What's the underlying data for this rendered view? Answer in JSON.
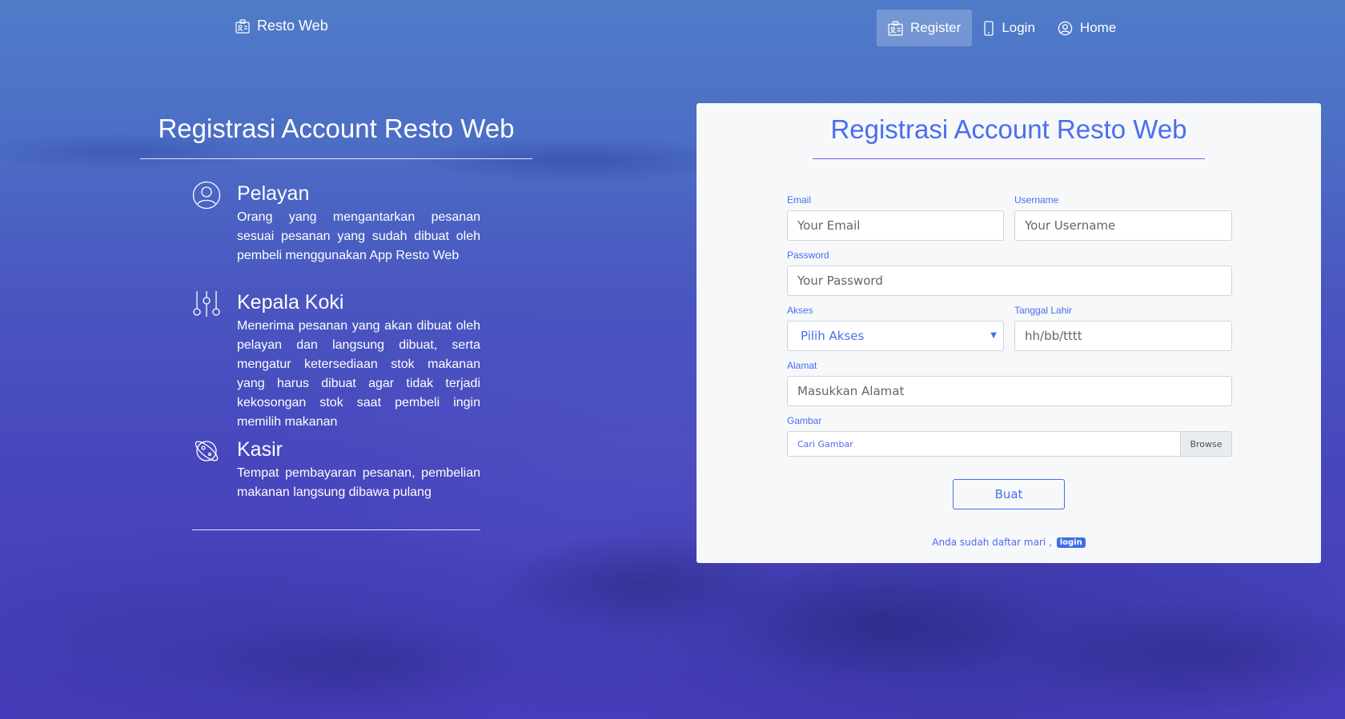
{
  "navbar": {
    "brand": "Resto Web",
    "items": [
      {
        "label": "Register",
        "icon": "id-card-icon",
        "active": true
      },
      {
        "label": "Login",
        "icon": "phone-icon",
        "active": false
      },
      {
        "label": "Home",
        "icon": "user-circle-icon",
        "active": false
      }
    ]
  },
  "left": {
    "title": "Registrasi Account Resto Web",
    "roles": [
      {
        "title": "Pelayan",
        "icon": "user-circle-icon",
        "description": "Orang yang mengantarkan pesanan sesuai pesanan yang sudah dibuat oleh pembeli menggunakan App Resto Web"
      },
      {
        "title": "Kepala Koki",
        "icon": "sliders-icon",
        "description": "Menerima pesanan yang akan dibuat oleh pelayan dan langsung dibuat, serta mengatur ketersediaan stok makanan yang harus dibuat agar tidak terjadi kekosongan stok saat pembeli ingin memilih makanan"
      },
      {
        "title": "Kasir",
        "icon": "planet-icon",
        "description": "Tempat pembayaran pesanan, pembelian makanan langsung dibawa pulang"
      }
    ]
  },
  "form": {
    "title": "Registrasi Account Resto Web",
    "email": {
      "label": "Email",
      "placeholder": "Your Email"
    },
    "username": {
      "label": "Username",
      "placeholder": "Your Username"
    },
    "password": {
      "label": "Password",
      "placeholder": "Your Password"
    },
    "akses": {
      "label": "Akses",
      "selected": "Pilih Akses"
    },
    "tanggal_lahir": {
      "label": "Tanggal Lahir",
      "placeholder": "hh/bb/tttt"
    },
    "alamat": {
      "label": "Alamat",
      "placeholder": "Masukkan Alamat"
    },
    "gambar": {
      "label": "Gambar",
      "placeholder": "Cari Gambar",
      "browse": "Browse"
    },
    "submit": "Buat",
    "footer": "Anda sudah daftar mari ,",
    "login_link": "login"
  },
  "colors": {
    "accent": "#4a6ef0",
    "badge": "#3d6fe8",
    "background": "#4b48c4"
  }
}
